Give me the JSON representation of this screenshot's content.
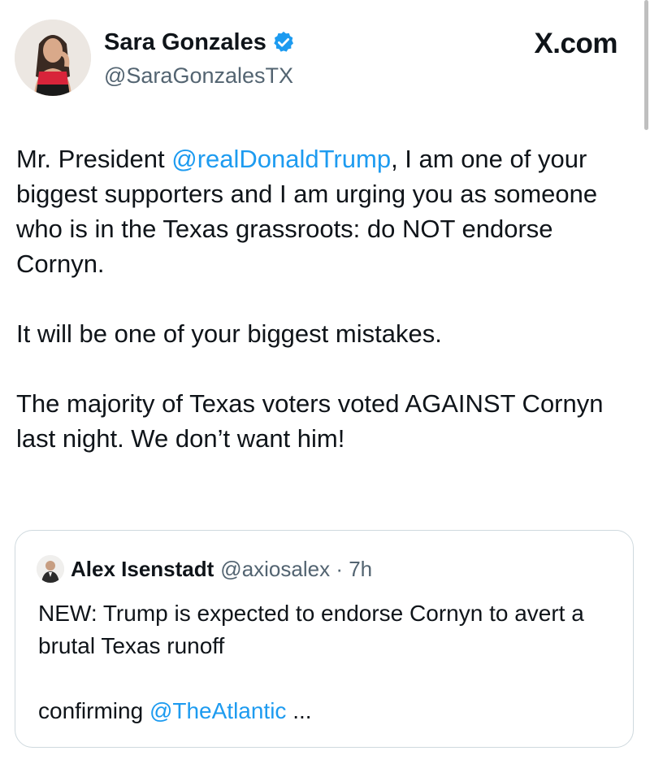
{
  "header": {
    "display_name": "Sara Gonzales",
    "handle": "@SaraGonzalesTX",
    "brand": "X.com",
    "verified_icon": "verified-badge-icon",
    "accent_color": "#1d9bf0"
  },
  "tweet": {
    "p1_before": "Mr. President ",
    "p1_mention": "@realDonaldTrump",
    "p1_after": ", I am one of your biggest supporters and I am urging you as someone who is in the Texas grassroots: do NOT endorse Cornyn.",
    "p2": "It will be one of your biggest mistakes.",
    "p3": "The majority of Texas voters voted AGAINST Cornyn last night. We don’t want him!"
  },
  "quote": {
    "name": "Alex Isenstadt",
    "handle": "@axiosalex",
    "separator": " · ",
    "time": "7h",
    "text": "NEW: Trump is expected to endorse Cornyn to avert a brutal Texas runoff",
    "confirming": "confirming ",
    "mention": "@TheAtlantic",
    "ellipsis": " ..."
  }
}
